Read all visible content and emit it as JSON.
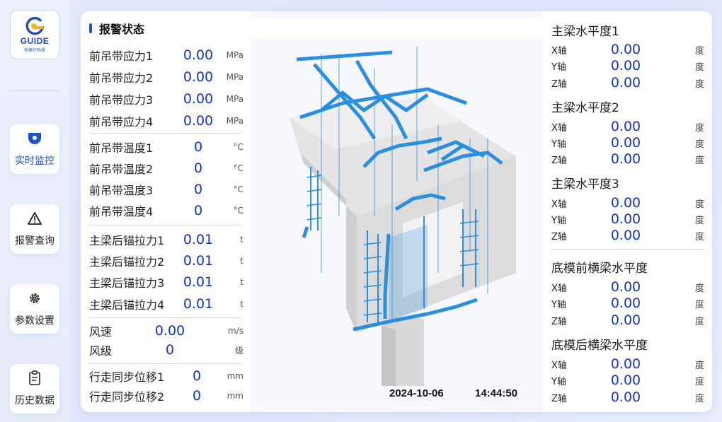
{
  "logo": {
    "text": "GUIDE",
    "sub": "恺德尔科技"
  },
  "nav": [
    {
      "label": "实时监控",
      "icon": "monitor-camera-icon",
      "active": true
    },
    {
      "label": "报警查询",
      "icon": "warning-triangle-icon",
      "active": false
    },
    {
      "label": "参数设置",
      "icon": "gear-icon",
      "active": false
    },
    {
      "label": "历史数据",
      "icon": "clipboard-icon",
      "active": false
    }
  ],
  "header": {
    "title": "报警状态"
  },
  "left": {
    "stress": [
      {
        "label": "前吊带应力1",
        "value": "0.00",
        "unit": "MPa"
      },
      {
        "label": "前吊带应力2",
        "value": "0.00",
        "unit": "MPa"
      },
      {
        "label": "前吊带应力3",
        "value": "0.00",
        "unit": "MPa"
      },
      {
        "label": "前吊带应力4",
        "value": "0.00",
        "unit": "MPa"
      }
    ],
    "temp": [
      {
        "label": "前吊带温度1",
        "value": "0",
        "unit": "°C"
      },
      {
        "label": "前吊带温度2",
        "value": "0",
        "unit": "°C"
      },
      {
        "label": "前吊带温度3",
        "value": "0",
        "unit": "°C"
      },
      {
        "label": "前吊带温度4",
        "value": "0",
        "unit": "°C"
      }
    ],
    "anchor": [
      {
        "label": "主梁后锚拉力1",
        "value": "0.01",
        "unit": "t"
      },
      {
        "label": "主梁后锚拉力2",
        "value": "0.01",
        "unit": "t"
      },
      {
        "label": "主梁后锚拉力3",
        "value": "0.01",
        "unit": "t"
      },
      {
        "label": "主梁后锚拉力4",
        "value": "0.01",
        "unit": "t"
      }
    ],
    "wind": [
      {
        "label": "风速",
        "value": "0.00",
        "unit": "m/s"
      },
      {
        "label": "风级",
        "value": "0",
        "unit": "级"
      }
    ],
    "walk": [
      {
        "label": "行走同步位移1",
        "value": "0",
        "unit": "mm"
      },
      {
        "label": "行走同步位移2",
        "value": "0",
        "unit": "mm"
      }
    ]
  },
  "center": {
    "date": "2024-10-06",
    "time": "14:44:50"
  },
  "right": {
    "sections": [
      {
        "title": "主梁水平度1",
        "axes": [
          {
            "axis": "X轴",
            "value": "0.00",
            "unit": "度"
          },
          {
            "axis": "Y轴",
            "value": "0.00",
            "unit": "度"
          },
          {
            "axis": "Z轴",
            "value": "0.00",
            "unit": "度"
          }
        ]
      },
      {
        "title": "主梁水平度2",
        "axes": [
          {
            "axis": "X轴",
            "value": "0.00",
            "unit": "度"
          },
          {
            "axis": "Y轴",
            "value": "0.00",
            "unit": "度"
          },
          {
            "axis": "Z轴",
            "value": "0.00",
            "unit": "度"
          }
        ]
      },
      {
        "title": "主梁水平度3",
        "axes": [
          {
            "axis": "X轴",
            "value": "0.00",
            "unit": "度"
          },
          {
            "axis": "Y轴",
            "value": "0.00",
            "unit": "度"
          },
          {
            "axis": "Z轴",
            "value": "0.00",
            "unit": "度"
          }
        ]
      },
      {
        "title": "底模前横梁水平度",
        "axes": [
          {
            "axis": "X轴",
            "value": "0.00",
            "unit": "度"
          },
          {
            "axis": "Y轴",
            "value": "0.00",
            "unit": "度"
          },
          {
            "axis": "Z轴",
            "value": "0.00",
            "unit": "度"
          }
        ]
      },
      {
        "title": "底模后横梁水平度",
        "axes": [
          {
            "axis": "X轴",
            "value": "0.00",
            "unit": "度"
          },
          {
            "axis": "Y轴",
            "value": "0.00",
            "unit": "度"
          },
          {
            "axis": "Z轴",
            "value": "0.00",
            "unit": "度"
          }
        ]
      }
    ]
  },
  "colors": {
    "accent": "#1f52c9",
    "value": "#1533c8",
    "truss": "#2a8fe0"
  }
}
